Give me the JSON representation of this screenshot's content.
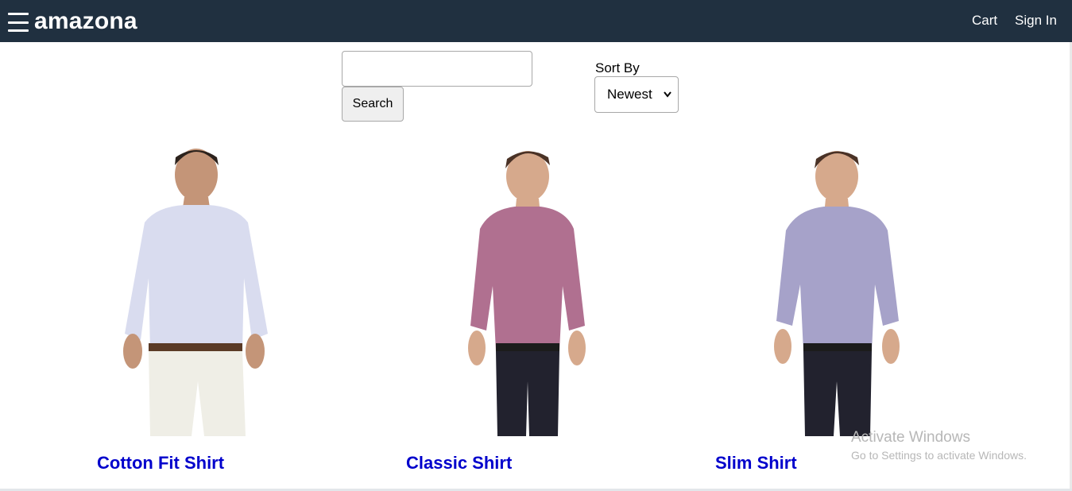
{
  "header": {
    "brand": "amazona",
    "menu_icon": "hamburger-menu-icon",
    "nav": {
      "cart": "Cart",
      "sign_in": "Sign In"
    },
    "bg_color": "#203040"
  },
  "search": {
    "input_value": "",
    "placeholder": "",
    "button_label": "Search"
  },
  "sort": {
    "label": "Sort By",
    "selected": "Newest",
    "chevron_icon": "chevron-down-icon"
  },
  "products": [
    {
      "name": "Cotton Fit Shirt",
      "shirt_color": "#d9dcef",
      "pants_color": "#efeee6"
    },
    {
      "name": "Classic Shirt",
      "shirt_color": "#b07090",
      "pants_color": "#22222e"
    },
    {
      "name": "Slim Shirt",
      "shirt_color": "#a6a2c9",
      "pants_color": "#22222e"
    }
  ],
  "watermark": {
    "title": "Activate Windows",
    "subtitle": "Go to Settings to activate Windows."
  },
  "colors": {
    "link": "#0000cc",
    "header": "#203040"
  }
}
